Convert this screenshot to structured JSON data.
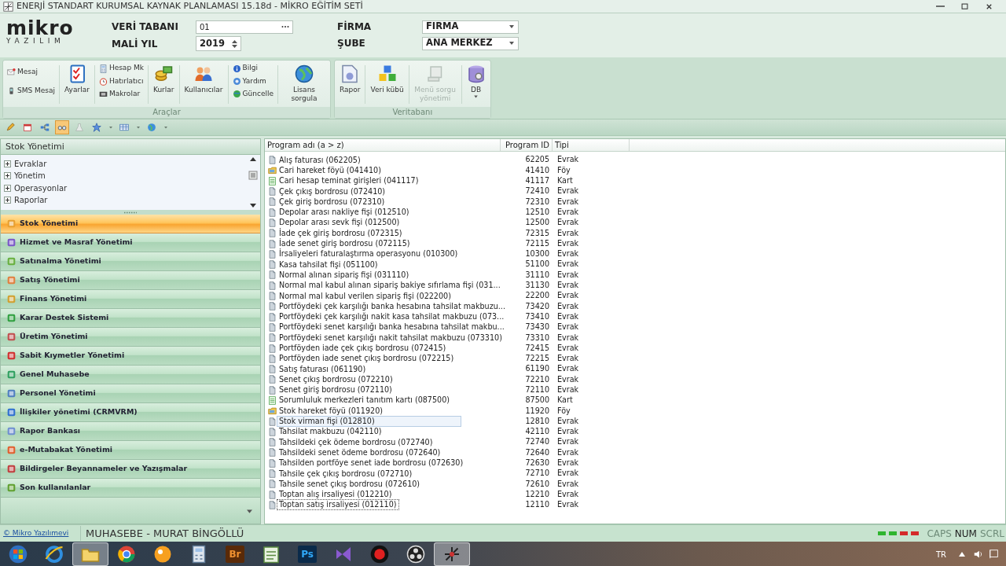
{
  "window": {
    "title": "ENERJİ STANDART KURUMSAL KAYNAK PLANLAMASI 15.18d - MİKRO EĞİTİM SETİ"
  },
  "logo": {
    "name": "mikro",
    "tagline": "YAZILIM"
  },
  "header_fields": [
    {
      "label": "VERİ TABANI",
      "value": "01",
      "kind": "browse"
    },
    {
      "label": "MALİ YIL",
      "value": "2019",
      "kind": "spin"
    },
    {
      "label": "FİRMA",
      "value": "FIRMA",
      "kind": "select"
    },
    {
      "label": "ŞUBE",
      "value": "ANA MERKEZ",
      "kind": "select"
    }
  ],
  "ribbon": [
    {
      "label": "Araçlar",
      "items": [
        {
          "kind": "stack",
          "buttons": [
            {
              "label": "Mesaj"
            },
            {
              "label": "SMS Mesaj"
            }
          ]
        },
        {
          "kind": "large",
          "label": "Ayarlar",
          "disabled": false,
          "dropdown": false
        },
        {
          "kind": "stack",
          "buttons": [
            {
              "label": "Hesap Mk"
            },
            {
              "label": "Hatırlatıcı"
            },
            {
              "label": "Makrolar"
            }
          ]
        },
        {
          "kind": "large",
          "label": "Kurlar",
          "disabled": false,
          "dropdown": false
        },
        {
          "kind": "large",
          "label": "Kullanıcılar",
          "disabled": false,
          "dropdown": false
        },
        {
          "kind": "stack",
          "buttons": [
            {
              "label": "Bilgi"
            },
            {
              "label": "Yardım"
            },
            {
              "label": "Güncelle"
            }
          ]
        },
        {
          "kind": "large",
          "label": "Lisans sorgula",
          "disabled": false,
          "dropdown": false
        }
      ]
    },
    {
      "label": "Veritabanı",
      "items": [
        {
          "kind": "large",
          "label": "Rapor",
          "disabled": false,
          "dropdown": false
        },
        {
          "kind": "large",
          "label": "Veri kübü",
          "disabled": false,
          "dropdown": false
        },
        {
          "kind": "large",
          "label": "Menü sorgu yönetimi",
          "disabled": true,
          "dropdown": false
        },
        {
          "kind": "large",
          "label": "DB",
          "disabled": false,
          "dropdown": true
        }
      ]
    }
  ],
  "quick_toolbar": [
    {
      "kind": "pencil",
      "selected": false
    },
    {
      "kind": "calendar",
      "selected": false
    },
    {
      "kind": "hierarchy",
      "selected": false
    },
    {
      "kind": "glasses",
      "selected": true
    },
    {
      "kind": "flask",
      "selected": false
    },
    {
      "kind": "star",
      "selected": false
    },
    {
      "kind": "caret",
      "selected": false
    },
    {
      "kind": "grid",
      "selected": false
    },
    {
      "kind": "caret",
      "selected": false
    },
    {
      "kind": "globe",
      "selected": false
    },
    {
      "kind": "caret",
      "selected": false
    }
  ],
  "left_panel": {
    "title": "Stok Yönetimi",
    "tree": [
      {
        "label": "Evraklar",
        "expanded": false
      },
      {
        "label": "Yönetim",
        "expanded": false
      },
      {
        "label": "Operasyonlar",
        "expanded": false
      },
      {
        "label": "Raporlar",
        "expanded": false
      }
    ],
    "modules": [
      {
        "label": "Stok Yönetimi",
        "selected": true
      },
      {
        "label": "Hizmet ve Masraf Yönetimi",
        "selected": false
      },
      {
        "label": "Satınalma Yönetimi",
        "selected": false
      },
      {
        "label": "Satış Yönetimi",
        "selected": false
      },
      {
        "label": "Finans Yönetimi",
        "selected": false
      },
      {
        "label": "Karar Destek Sistemi",
        "selected": false
      },
      {
        "label": "Üretim Yönetimi",
        "selected": false
      },
      {
        "label": "Sabit Kıymetler Yönetimi",
        "selected": false
      },
      {
        "label": "Genel Muhasebe",
        "selected": false
      },
      {
        "label": "Personel Yönetimi",
        "selected": false
      },
      {
        "label": "İlişkiler yönetimi (CRMVRM)",
        "selected": false
      },
      {
        "label": "Rapor Bankası",
        "selected": false
      },
      {
        "label": "e-Mutabakat Yönetimi",
        "selected": false
      },
      {
        "label": "Bildirgeler Beyannameler ve Yazışmalar",
        "selected": false
      },
      {
        "label": "Son kullanılanlar",
        "selected": false
      }
    ]
  },
  "table": {
    "columns": [
      "Program adı (a > z)",
      "Program ID",
      "Tipi"
    ],
    "rows": [
      {
        "name": "Alış faturası (062205)",
        "id": "62205",
        "type": "Evrak",
        "kind": "document",
        "hovered": false,
        "selected": false
      },
      {
        "name": "Cari hareket föyü (041410)",
        "id": "41410",
        "type": "Föy",
        "kind": "sheet",
        "hovered": false,
        "selected": false
      },
      {
        "name": "Cari hesap teminat girişleri (041117)",
        "id": "41117",
        "type": "Kart",
        "kind": "card",
        "hovered": false,
        "selected": false
      },
      {
        "name": "Çek çıkış bordrosu (072410)",
        "id": "72410",
        "type": "Evrak",
        "kind": "document",
        "hovered": false,
        "selected": false
      },
      {
        "name": "Çek giriş bordrosu (072310)",
        "id": "72310",
        "type": "Evrak",
        "kind": "document",
        "hovered": false,
        "selected": false
      },
      {
        "name": "Depolar arası nakliye fişi (012510)",
        "id": "12510",
        "type": "Evrak",
        "kind": "document",
        "hovered": false,
        "selected": false
      },
      {
        "name": "Depolar arası sevk fişi (012500)",
        "id": "12500",
        "type": "Evrak",
        "kind": "document",
        "hovered": false,
        "selected": false
      },
      {
        "name": "İade çek giriş bordrosu (072315)",
        "id": "72315",
        "type": "Evrak",
        "kind": "document",
        "hovered": false,
        "selected": false
      },
      {
        "name": "İade senet giriş bordrosu (072115)",
        "id": "72115",
        "type": "Evrak",
        "kind": "document",
        "hovered": false,
        "selected": false
      },
      {
        "name": "İrsaliyeleri faturalaştırma operasyonu (010300)",
        "id": "10300",
        "type": "Evrak",
        "kind": "document",
        "hovered": false,
        "selected": false
      },
      {
        "name": "Kasa tahsilat fişi (051100)",
        "id": "51100",
        "type": "Evrak",
        "kind": "document",
        "hovered": false,
        "selected": false
      },
      {
        "name": "Normal alınan sipariş fişi (031110)",
        "id": "31110",
        "type": "Evrak",
        "kind": "document",
        "hovered": false,
        "selected": false
      },
      {
        "name": "Normal mal kabul alınan sipariş bakiye sıfırlama fişi (031...",
        "id": "31130",
        "type": "Evrak",
        "kind": "document",
        "hovered": false,
        "selected": false
      },
      {
        "name": "Normal mal kabul verilen sipariş fişi (022200)",
        "id": "22200",
        "type": "Evrak",
        "kind": "document",
        "hovered": false,
        "selected": false
      },
      {
        "name": "Portföydeki çek karşılığı banka hesabına tahsilat makbuzu...",
        "id": "73420",
        "type": "Evrak",
        "kind": "document",
        "hovered": false,
        "selected": false
      },
      {
        "name": "Portföydeki çek karşılığı nakit kasa tahsilat makbuzu (073...",
        "id": "73410",
        "type": "Evrak",
        "kind": "document",
        "hovered": false,
        "selected": false
      },
      {
        "name": "Portföydeki senet karşılığı banka hesabına tahsilat makbu...",
        "id": "73430",
        "type": "Evrak",
        "kind": "document",
        "hovered": false,
        "selected": false
      },
      {
        "name": "Portföydeki senet karşılığı nakit tahsilat makbuzu (073310)",
        "id": "73310",
        "type": "Evrak",
        "kind": "document",
        "hovered": false,
        "selected": false
      },
      {
        "name": "Portföyden iade çek çıkış bordrosu (072415)",
        "id": "72415",
        "type": "Evrak",
        "kind": "document",
        "hovered": false,
        "selected": false
      },
      {
        "name": "Portföyden iade senet çıkış bordrosu (072215)",
        "id": "72215",
        "type": "Evrak",
        "kind": "document",
        "hovered": false,
        "selected": false
      },
      {
        "name": "Satış faturası (061190)",
        "id": "61190",
        "type": "Evrak",
        "kind": "document",
        "hovered": false,
        "selected": false
      },
      {
        "name": "Senet çıkış bordrosu (072210)",
        "id": "72210",
        "type": "Evrak",
        "kind": "document",
        "hovered": false,
        "selected": false
      },
      {
        "name": "Senet giriş bordrosu (072110)",
        "id": "72110",
        "type": "Evrak",
        "kind": "document",
        "hovered": false,
        "selected": false
      },
      {
        "name": "Sorumluluk merkezleri tanıtım kartı (087500)",
        "id": "87500",
        "type": "Kart",
        "kind": "card",
        "hovered": false,
        "selected": false
      },
      {
        "name": "Stok hareket föyü (011920)",
        "id": "11920",
        "type": "Föy",
        "kind": "sheet",
        "hovered": false,
        "selected": false
      },
      {
        "name": "Stok virman fişi (012810)",
        "id": "12810",
        "type": "Evrak",
        "kind": "document",
        "hovered": true,
        "selected": false
      },
      {
        "name": "Tahsilat makbuzu (042110)",
        "id": "42110",
        "type": "Evrak",
        "kind": "document",
        "hovered": false,
        "selected": false
      },
      {
        "name": "Tahsildeki çek ödeme bordrosu (072740)",
        "id": "72740",
        "type": "Evrak",
        "kind": "document",
        "hovered": false,
        "selected": false
      },
      {
        "name": "Tahsildeki senet ödeme bordrosu (072640)",
        "id": "72640",
        "type": "Evrak",
        "kind": "document",
        "hovered": false,
        "selected": false
      },
      {
        "name": "Tahsilden portföye senet iade bordrosu (072630)",
        "id": "72630",
        "type": "Evrak",
        "kind": "document",
        "hovered": false,
        "selected": false
      },
      {
        "name": "Tahsile çek çıkış bordrosu (072710)",
        "id": "72710",
        "type": "Evrak",
        "kind": "document",
        "hovered": false,
        "selected": false
      },
      {
        "name": "Tahsile senet çıkış bordrosu (072610)",
        "id": "72610",
        "type": "Evrak",
        "kind": "document",
        "hovered": false,
        "selected": false
      },
      {
        "name": "Toptan alış irsaliyesi (012210)",
        "id": "12210",
        "type": "Evrak",
        "kind": "document",
        "hovered": false,
        "selected": false
      },
      {
        "name": "Toptan satış irsaliyesi (012110)",
        "id": "12110",
        "type": "Evrak",
        "kind": "document",
        "hovered": false,
        "selected": true
      }
    ]
  },
  "status_bar": {
    "link": "© Mikro Yazılımevi",
    "user": "MUHASEBE - MURAT BİNGÖLLÜ",
    "lights": [
      {
        "color": "#2fb52f"
      },
      {
        "color": "#2fb52f"
      },
      {
        "color": "#d42a2a"
      },
      {
        "color": "#d42a2a"
      }
    ],
    "keys": [
      {
        "label": "CAPS",
        "on": false
      },
      {
        "label": "NUM",
        "on": true
      },
      {
        "label": "SCRL",
        "on": false
      }
    ]
  },
  "taskbar": {
    "items": [
      {
        "kind": "start",
        "selected": false
      },
      {
        "kind": "browser",
        "selected": false
      },
      {
        "kind": "folder",
        "selected": true
      },
      {
        "kind": "wheel",
        "selected": false
      },
      {
        "kind": "bubble",
        "selected": false
      },
      {
        "kind": "calculator",
        "selected": false
      },
      {
        "kind": "tile",
        "label": "Br",
        "selected": false
      },
      {
        "kind": "notepad",
        "selected": false
      },
      {
        "kind": "tile",
        "label": "Ps",
        "selected": false
      },
      {
        "kind": "ribbon",
        "selected": false
      },
      {
        "kind": "record",
        "selected": false
      },
      {
        "kind": "lens",
        "selected": false
      },
      {
        "kind": "app",
        "selected": true
      }
    ],
    "language": "TR"
  }
}
